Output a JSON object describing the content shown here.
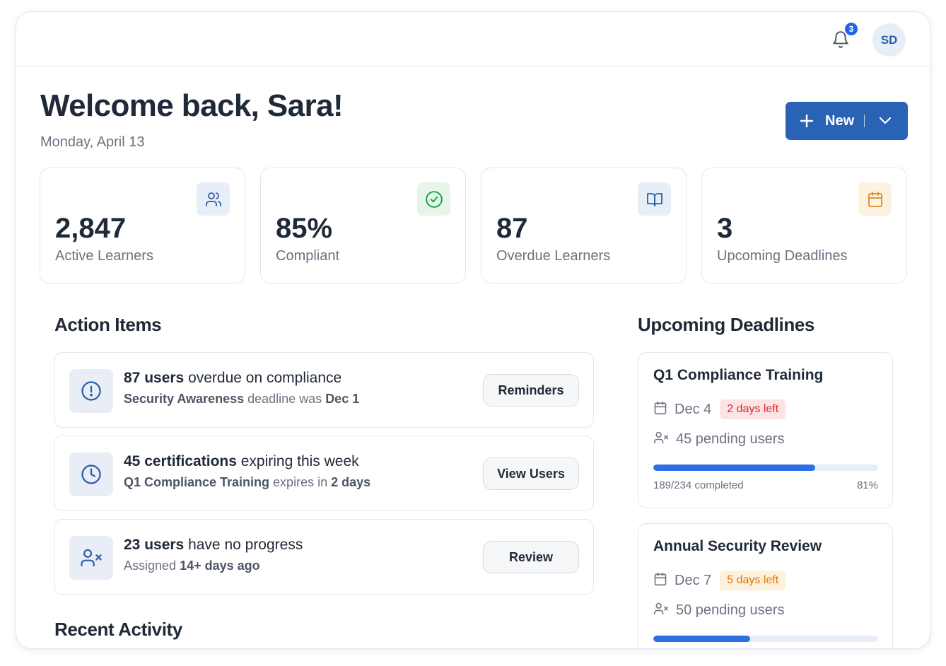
{
  "topbar": {
    "notifications_count": "3",
    "avatar_initials": "SD"
  },
  "header": {
    "welcome": "Welcome back, Sara!",
    "date": "Monday, April 13",
    "new_button_label": "New"
  },
  "stats": [
    {
      "value": "2,847",
      "label": "Active Learners",
      "icon": "users-icon",
      "icon_color": "#2a5ea5",
      "icon_bg": "#e8eef8"
    },
    {
      "value": "85%",
      "label": "Compliant",
      "icon": "check-circle-icon",
      "icon_color": "#16a34a",
      "icon_bg": "#e6f4ea"
    },
    {
      "value": "87",
      "label": "Overdue Learners",
      "icon": "book-open-icon",
      "icon_color": "#2a5ea5",
      "icon_bg": "#e8eef8"
    },
    {
      "value": "3",
      "label": "Upcoming Deadlines",
      "icon": "calendar-icon",
      "icon_color": "#e08a1e",
      "icon_bg": "#fdf1e2"
    }
  ],
  "action_items": {
    "title": "Action Items",
    "items": [
      {
        "icon": "alert-circle-icon",
        "bold": "87 users",
        "text": " overdue on compliance",
        "sub_bold1": "Security Awareness",
        "sub_text": " deadline was ",
        "sub_bold2": "Dec 1",
        "button": "Reminders"
      },
      {
        "icon": "clock-icon",
        "bold": "45 certifications",
        "text": " expiring this week",
        "sub_bold1": "Q1 Compliance Training",
        "sub_text": " expires in ",
        "sub_bold2": "2 days",
        "button": "View Users"
      },
      {
        "icon": "user-x-icon",
        "bold": "23 users",
        "text": " have no progress",
        "sub_bold1": "",
        "sub_text": "Assigned ",
        "sub_bold2": "14+ days ago",
        "button": "Review"
      }
    ]
  },
  "recent_activity": {
    "title": "Recent Activity"
  },
  "deadlines": {
    "title": "Upcoming Deadlines",
    "items": [
      {
        "title": "Q1 Compliance Training",
        "date": "Dec 4",
        "badge": "2 days left",
        "badge_color": "#dc2626",
        "pending": "45 pending users",
        "completed": "189/234 completed",
        "percent": "81%",
        "progress": 0.72
      },
      {
        "title": "Annual Security Review",
        "date": "Dec 7",
        "badge": "5 days left",
        "badge_color": "#d97706",
        "pending": "50 pending users",
        "progress": 0.43
      }
    ]
  }
}
